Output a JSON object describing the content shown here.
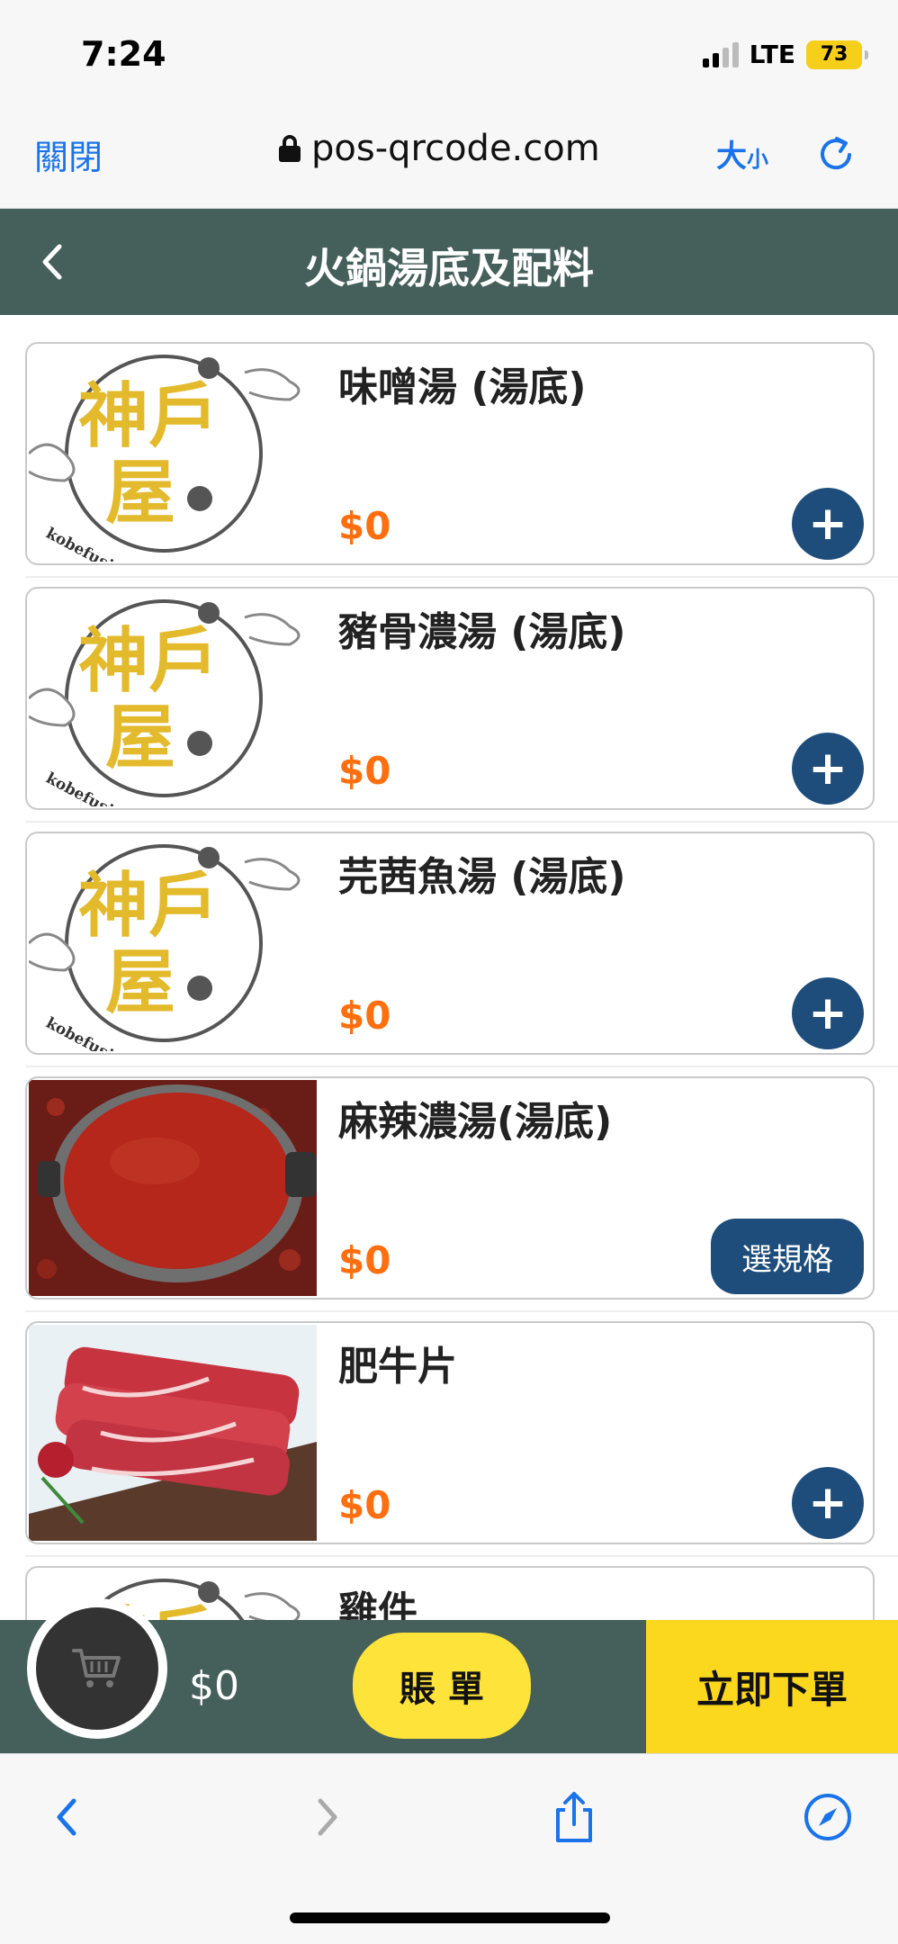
{
  "status_bar": {
    "time": "7:24",
    "network": "LTE",
    "battery": "73"
  },
  "browser": {
    "close_label": "關閉",
    "url": "pos-qrcode.com",
    "text_size_big": "大",
    "text_size_small": "小"
  },
  "header": {
    "title": "火鍋湯底及配料"
  },
  "menu_items": [
    {
      "name": "味噌湯 (湯底)",
      "price": "$0",
      "action": "+",
      "thumbnail": "logo"
    },
    {
      "name": "豬骨濃湯 (湯底)",
      "price": "$0",
      "action": "+",
      "thumbnail": "logo"
    },
    {
      "name": "芫茜魚湯 (湯底)",
      "price": "$0",
      "action": "+",
      "thumbnail": "logo"
    },
    {
      "name": "麻辣濃湯(湯底)",
      "price": "$0",
      "action": "選規格",
      "thumbnail": "spicy-soup-photo"
    },
    {
      "name": "肥牛片",
      "price": "$0",
      "action": "+",
      "thumbnail": "beef-photo"
    },
    {
      "name": "雞件",
      "price": "",
      "action": "",
      "thumbnail": "logo"
    }
  ],
  "order_bar": {
    "cart_total": "$0",
    "bill_label": "賬 單",
    "order_now_label": "立即下單"
  },
  "logo": {
    "line1": "神戶",
    "line2": "屋",
    "arc_text": "kobefusion restaurant"
  },
  "colors": {
    "header_bg": "#455f5b",
    "price": "#ff6f0f",
    "button": "#1e4d7b",
    "accent_yellow": "#fbd71d",
    "link_blue": "#1a73e8"
  }
}
